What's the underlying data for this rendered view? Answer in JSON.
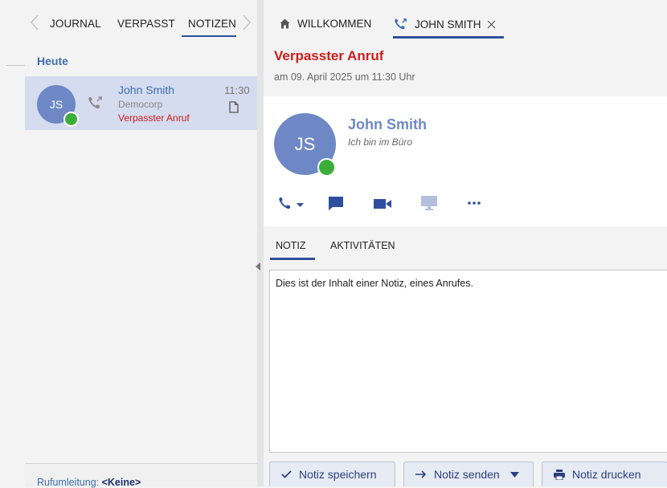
{
  "left": {
    "tabs": [
      "JOURNAL",
      "VERPASST",
      "NOTIZEN"
    ],
    "group_label": "Heute",
    "call": {
      "initials": "JS",
      "name": "John Smith",
      "company": "Democorp",
      "status": "Verpasster Anruf",
      "time": "11:30"
    },
    "footer": {
      "label": "Rufumleitung:",
      "value": "<Keine>"
    }
  },
  "right": {
    "tabs": [
      {
        "label": "WILLKOMMEN",
        "icon": "home-icon"
      },
      {
        "label": "JOHN SMITH",
        "icon": "missed-call-icon"
      }
    ],
    "call_title": "Verpasster Anruf",
    "call_date": "am 09. April 2025 um 11:30 Uhr",
    "contact": {
      "initials": "JS",
      "name": "John Smith",
      "status": "Ich bin im Büro",
      "actions": [
        "phone-icon",
        "chat-icon",
        "video-icon",
        "screen-share-icon",
        "more-icon"
      ]
    },
    "note_tabs": [
      "NOTIZ",
      "AKTIVITÄTEN"
    ],
    "note_text": "Dies ist der Inhalt einer Notiz, eines Anrufes.",
    "buttons": {
      "save": "Notiz speichern",
      "send": "Notiz senden",
      "print": "Notiz drucken"
    }
  },
  "colors": {
    "accent": "#2f4f9c",
    "link_blue": "#3f6db0",
    "avatar": "#6e88c5",
    "presence_available": "#3cae3a",
    "missed_red": "#cc1d1d",
    "selected_row": "#d5dcef"
  }
}
